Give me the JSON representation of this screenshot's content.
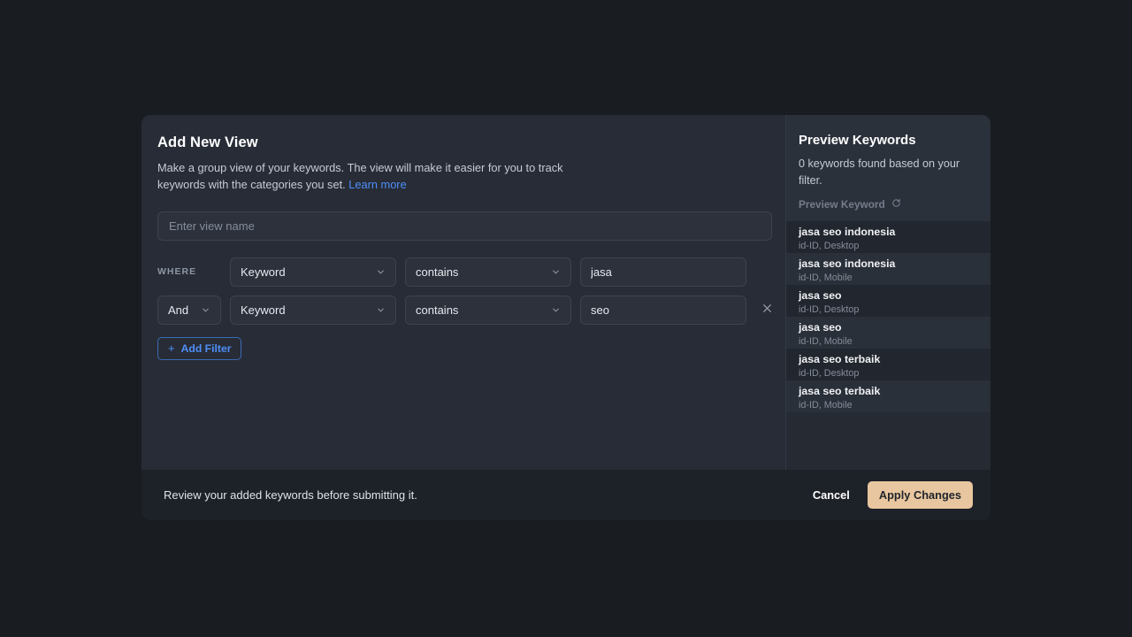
{
  "dialog": {
    "title": "Add New View",
    "description": "Make a group view of your keywords. The view will make it easier for you to track keywords with the categories you set.",
    "learn_more_label": "Learn more",
    "view_name_placeholder": "Enter view name",
    "view_name_value": ""
  },
  "filters": {
    "where_label": "WHERE",
    "add_filter_label": "Add Filter",
    "add_filter_plus": "+",
    "remove_icon": "close-icon",
    "rows": [
      {
        "conjunction": "",
        "field": "Keyword",
        "operator": "contains",
        "value": "jasa",
        "removable": false
      },
      {
        "conjunction": "And",
        "field": "Keyword",
        "operator": "contains",
        "value": "seo",
        "removable": true
      }
    ]
  },
  "preview": {
    "title": "Preview Keywords",
    "summary": "0 keywords found based on your filter.",
    "preview_keyword_label": "Preview Keyword",
    "refresh_icon": "refresh-icon",
    "keywords": [
      {
        "name": "jasa seo indonesia",
        "meta": "id-ID, Desktop"
      },
      {
        "name": "jasa seo indonesia",
        "meta": "id-ID, Mobile"
      },
      {
        "name": "jasa seo",
        "meta": "id-ID, Desktop"
      },
      {
        "name": "jasa seo",
        "meta": "id-ID, Mobile"
      },
      {
        "name": "jasa seo terbaik",
        "meta": "id-ID, Desktop"
      },
      {
        "name": "jasa seo terbaik",
        "meta": "id-ID, Mobile"
      }
    ]
  },
  "footer": {
    "note": "Review your added keywords before submitting it.",
    "cancel_label": "Cancel",
    "apply_label": "Apply Changes"
  },
  "colors": {
    "page_background": "#191c21",
    "modal_background": "#272c36",
    "accent_link": "#4f8ef7",
    "apply_button": "#e8c69f",
    "footer_background": "#1d2128"
  }
}
